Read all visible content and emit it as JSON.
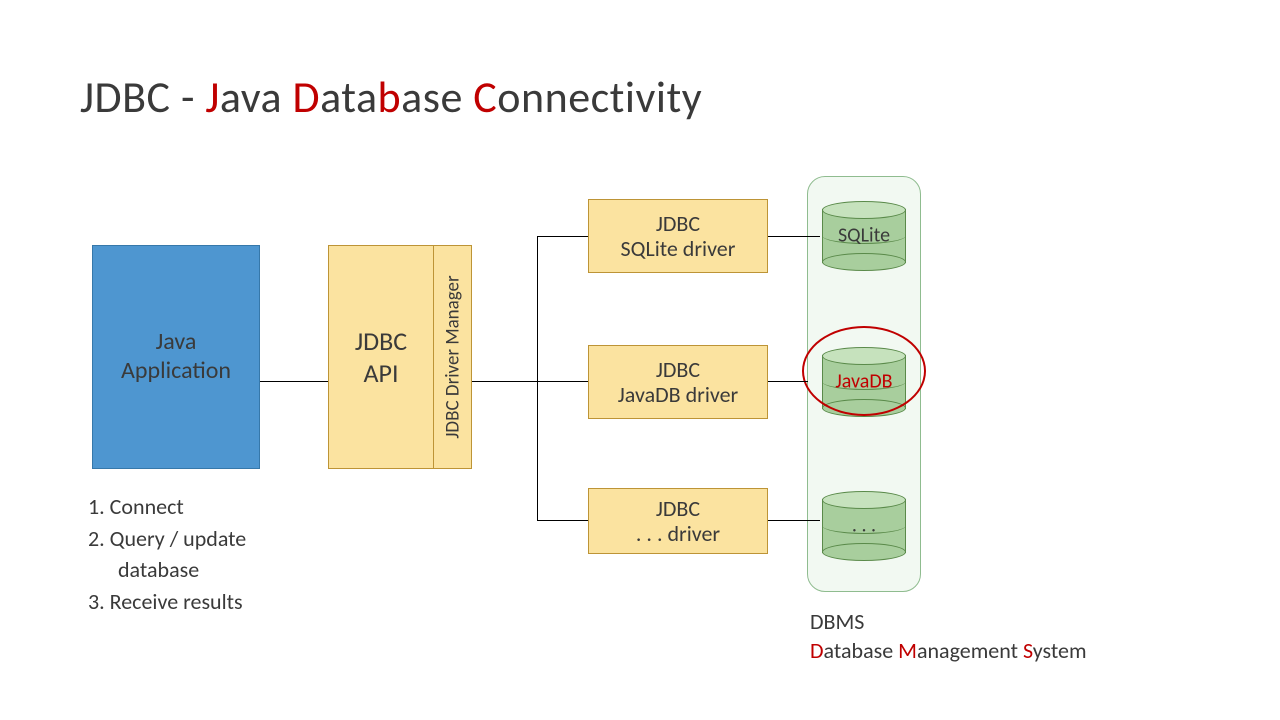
{
  "title": {
    "prefix": "JDBC - ",
    "j": "J",
    "java_rest": "ava ",
    "d": "D",
    "db_rest": "ata",
    "b": "b",
    "base_rest": "ase ",
    "c": "C",
    "conn_rest": "onnectivity"
  },
  "java_app": {
    "l1": "Java",
    "l2": "Application"
  },
  "jdbc_api": {
    "l1": "JDBC",
    "l2": "API"
  },
  "driver_manager": "JDBC Driver Manager",
  "drivers": {
    "d1": {
      "l1": "JDBC",
      "l2": "SQLite driver"
    },
    "d2": {
      "l1": "JDBC",
      "l2": "JavaDB driver"
    },
    "d3": {
      "l1": "JDBC",
      "l2": ". . . driver"
    }
  },
  "databases": {
    "db1": "SQLite",
    "db2": "JavaDB",
    "db3": ". . ."
  },
  "steps": {
    "s1": "1. Connect",
    "s2": "2. Query / update",
    "s2b": "database",
    "s3": "3. Receive results"
  },
  "dbms": {
    "line1": "DBMS",
    "d": "D",
    "d_rest": "atabase ",
    "m": "M",
    "m_rest": "anagement ",
    "s": "S",
    "s_rest": "ystem"
  }
}
